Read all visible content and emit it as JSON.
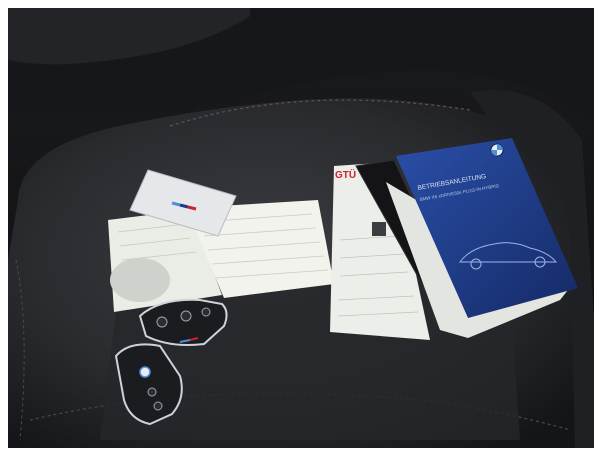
{
  "photo": {
    "manual_cover": {
      "title_line_1": "BETRIEBSANLEITUNG",
      "title_line_2": "BMW X5 xDRIVE50e PLUG-IN HYBRID"
    },
    "tag": {
      "label": "GTÜ"
    }
  },
  "colors": {
    "interior_dark": "#111214",
    "seat_leather": "#2a2b2f",
    "seat_highlight": "#3a3c41",
    "manual_blue": "#1f3c88",
    "paper": "#eef0ea",
    "key_fob": "#1b1c1f",
    "chrome": "#cfd3d8",
    "m_stripe_blue_light": "#4f8fd8",
    "m_stripe_blue_dark": "#1e3a8a",
    "m_stripe_red": "#d0212a"
  },
  "icons": [
    "bmw-logo-icon",
    "m-stripes-icon",
    "lock-icon",
    "unlock-icon",
    "trunk-icon"
  ]
}
